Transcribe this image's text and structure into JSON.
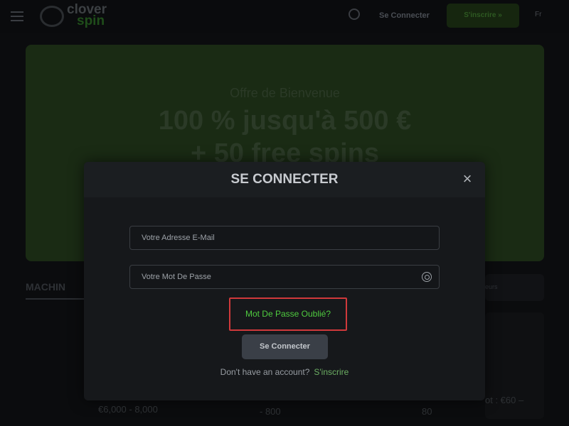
{
  "header": {
    "logo_line1": "clover",
    "logo_line2": "spin",
    "login_label": "Se Connecter",
    "signup_label": "S'inscrire »",
    "language": "Fr"
  },
  "banner": {
    "subtitle": "Offre de Bienvenue",
    "title_line1": "100 % jusqu'à 500 €",
    "title_line2": "+ 50 free spins"
  },
  "background": {
    "section_title": "MACHIN",
    "filter_label": "eurs",
    "card1_text": "€6,000 - 8,000",
    "card2_text": "- 800",
    "card3_text": "80",
    "card4_text": "ot : €60 –"
  },
  "modal": {
    "title": "SE CONNECTER",
    "email_placeholder": "Votre Adresse E-Mail",
    "password_placeholder": "Votre Mot De Passe",
    "forgot_label": "Mot De Passe Oublié?",
    "submit_label": "Se Connecter",
    "no_account_text": "Don't have an account?",
    "signup_link": "S'inscrire",
    "close_icon": "×"
  },
  "colors": {
    "accent_green": "#4fcb3f",
    "highlight_red": "#d0393b"
  }
}
